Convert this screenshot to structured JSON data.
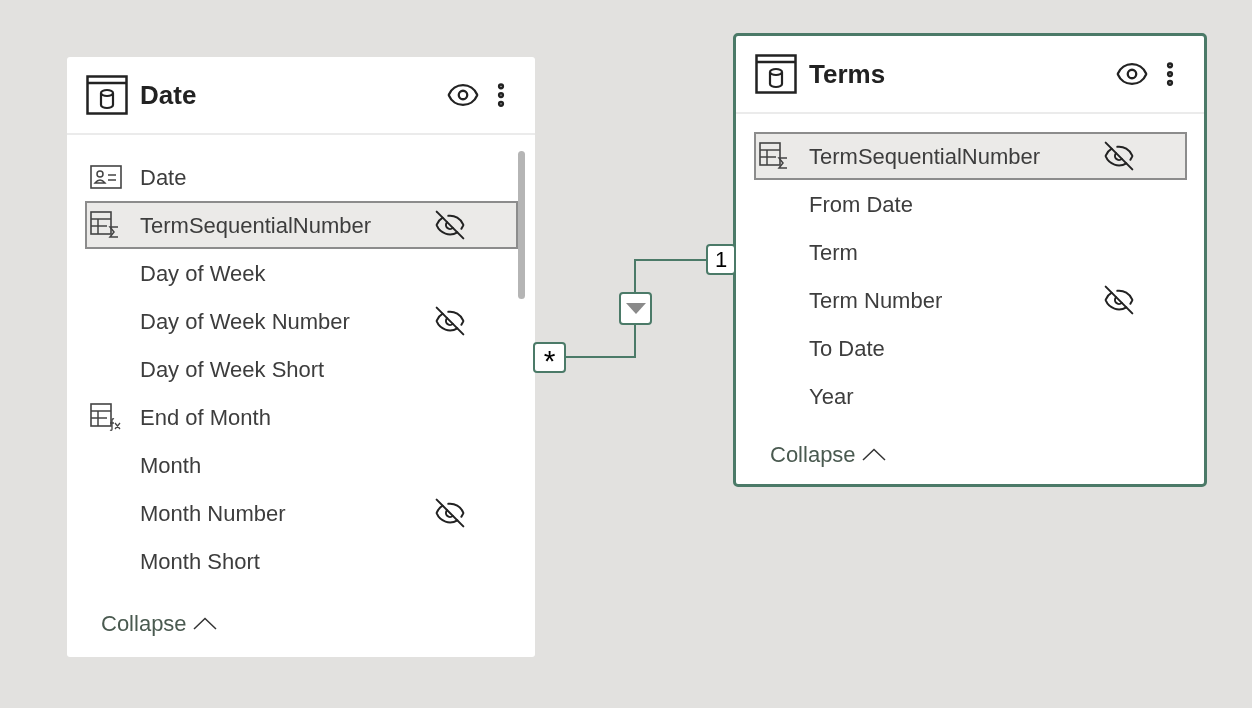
{
  "tables": [
    {
      "name": "Date",
      "selected": false,
      "collapse_label": "Collapse",
      "fields": [
        {
          "name": "Date",
          "kind": "key",
          "hidden": false,
          "selected": false
        },
        {
          "name": "TermSequentialNumber",
          "kind": "sum",
          "hidden": true,
          "selected": true
        },
        {
          "name": "Day of Week",
          "kind": "plain",
          "hidden": false,
          "selected": false
        },
        {
          "name": "Day of Week Number",
          "kind": "plain",
          "hidden": true,
          "selected": false
        },
        {
          "name": "Day of Week Short",
          "kind": "plain",
          "hidden": false,
          "selected": false
        },
        {
          "name": "End of Month",
          "kind": "calc",
          "hidden": false,
          "selected": false
        },
        {
          "name": "Month",
          "kind": "plain",
          "hidden": false,
          "selected": false
        },
        {
          "name": "Month Number",
          "kind": "plain",
          "hidden": true,
          "selected": false
        },
        {
          "name": "Month Short",
          "kind": "plain",
          "hidden": false,
          "selected": false
        }
      ]
    },
    {
      "name": "Terms",
      "selected": true,
      "collapse_label": "Collapse",
      "fields": [
        {
          "name": "TermSequentialNumber",
          "kind": "sum",
          "hidden": true,
          "selected": true
        },
        {
          "name": "From Date",
          "kind": "plain",
          "hidden": false,
          "selected": false
        },
        {
          "name": "Term",
          "kind": "plain",
          "hidden": false,
          "selected": false
        },
        {
          "name": "Term Number",
          "kind": "plain",
          "hidden": true,
          "selected": false
        },
        {
          "name": "To Date",
          "kind": "plain",
          "hidden": false,
          "selected": false
        },
        {
          "name": "Year",
          "kind": "plain",
          "hidden": false,
          "selected": false
        }
      ]
    }
  ],
  "relationship": {
    "from_cardinality": "*",
    "to_cardinality": "1"
  }
}
